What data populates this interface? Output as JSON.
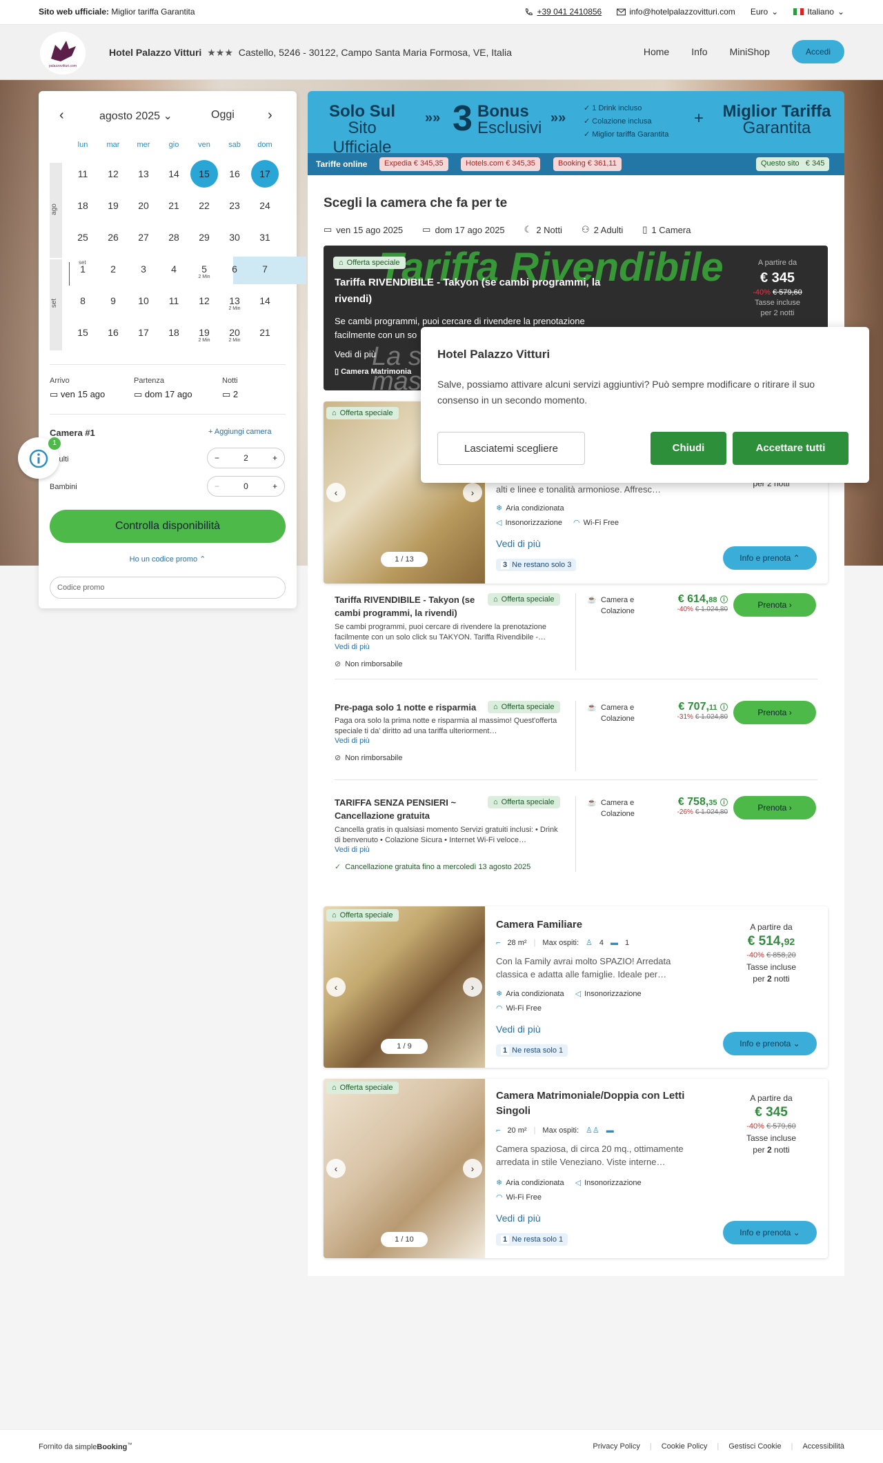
{
  "topbar": {
    "official_label": "Sito web ufficiale:",
    "official_text": "Miglior tariffa Garantita",
    "phone": "+39 041 2410856",
    "email": "info@hotelpalazzovitturi.com",
    "currency": "Euro",
    "language": "Italiano"
  },
  "header": {
    "logo_text": "palazzovitturi.com",
    "hotel_name": "Hotel Palazzo Vitturi",
    "stars": "★★★",
    "address": "Castello, 5246 - 30122, Campo Santa Maria Formosa, VE, Italia",
    "nav": [
      "Home",
      "Info",
      "MiniShop"
    ],
    "login": "Accedi"
  },
  "calendar": {
    "month": "agosto 2025",
    "today": "Oggi",
    "weekdays": [
      "lun",
      "mar",
      "mer",
      "gio",
      "ven",
      "sab",
      "dom"
    ],
    "month_labels": [
      "ago",
      "set"
    ],
    "set_label": "set",
    "rows": [
      [
        {
          "d": "11"
        },
        {
          "d": "12"
        },
        {
          "d": "13"
        },
        {
          "d": "14"
        },
        {
          "d": "15"
        },
        {
          "d": "16"
        },
        {
          "d": "17"
        }
      ],
      [
        {
          "d": "18"
        },
        {
          "d": "19"
        },
        {
          "d": "20"
        },
        {
          "d": "21"
        },
        {
          "d": "22"
        },
        {
          "d": "23"
        },
        {
          "d": "24"
        }
      ],
      [
        {
          "d": "25"
        },
        {
          "d": "26"
        },
        {
          "d": "27"
        },
        {
          "d": "28"
        },
        {
          "d": "29"
        },
        {
          "d": "30"
        },
        {
          "d": "31"
        }
      ],
      [
        {
          "d": "1"
        },
        {
          "d": "2"
        },
        {
          "d": "3"
        },
        {
          "d": "4"
        },
        {
          "d": "5",
          "s": "2 Min"
        },
        {
          "d": "6"
        },
        {
          "d": "7"
        }
      ],
      [
        {
          "d": "8"
        },
        {
          "d": "9"
        },
        {
          "d": "10"
        },
        {
          "d": "11"
        },
        {
          "d": "12"
        },
        {
          "d": "13",
          "s": "2 Min"
        },
        {
          "d": "14"
        }
      ],
      [
        {
          "d": "15"
        },
        {
          "d": "16"
        },
        {
          "d": "17"
        },
        {
          "d": "18"
        },
        {
          "d": "19",
          "s": "2 Min"
        },
        {
          "d": "20",
          "s": "2 Min"
        },
        {
          "d": "21"
        }
      ]
    ]
  },
  "stay": {
    "arrivo_label": "Arrivo",
    "arrivo": "ven 15 ago",
    "partenza_label": "Partenza",
    "partenza": "dom 17 ago",
    "notti_label": "Notti",
    "notti": "2"
  },
  "rooms_form": {
    "camera": "Camera #1",
    "add_room": "Aggiungi camera",
    "adults_label": "Adulti",
    "adults": "2",
    "children_label": "Bambini",
    "children": "0",
    "check": "Controlla disponibilità",
    "promo_link": "Ho un codice promo",
    "promo_placeholder": "Codice promo",
    "info_badge_count": "1"
  },
  "banner": {
    "solo1": "Solo Sul",
    "solo2": "Sito Ufficiale",
    "num": "3",
    "bonus1": "Bonus",
    "bonus2": "Esclusivi",
    "list": [
      "1 Drink incluso",
      "Colazione inclusa",
      "Miglior tariffa Garantita"
    ],
    "plus": "+",
    "best1": "Miglior Tariffa",
    "best2": "Garantita",
    "tariffe": "Tariffe online",
    "chips": [
      "Expedia € 345,35",
      "Hotels.com € 345,35",
      "Booking € 361,11"
    ],
    "this_site": "Questo sito   € 345"
  },
  "search": {
    "title": "Scegli la camera che fa per te",
    "from": "ven 15 ago 2025",
    "to": "dom 17 ago 2025",
    "nights": "2 Notti",
    "adults": "2 Adulti",
    "rooms": "1 Camera"
  },
  "dark_offer": {
    "badge": "Offerta speciale",
    "watermark": "Tariffa Rivendibile",
    "watermark2": "La so",
    "watermark3": "mas",
    "name": "Tariffa RIVENDIBILE - Takyon (se cambi programmi, la rivendi)",
    "desc": "Se cambi programmi, puoi cercare di rivendere la prenotazione facilmente con un so",
    "vedi": "Vedi di più",
    "room": "Camera Matrimonia",
    "from": "A partire da",
    "price": "€ 345",
    "disc": "-40%",
    "old": "€ 579,60",
    "tax": "Tasse incluse",
    "per": "per 2 notti"
  },
  "cookie": {
    "title": "Hotel Palazzo Vitturi",
    "text": "Salve, possiamo attivare alcuni servizi aggiuntivi? Può sempre modificare o ritirare il suo consenso in un secondo momento.",
    "choose": "Lasciatemi scegliere",
    "close": "Chiudi",
    "accept": "Accettare tutti"
  },
  "room1": {
    "badge": "Offerta speciale",
    "desc_tail": "alti e linee e tonalità armoniose. Affresc…",
    "per_tail": "per 2 notti",
    "am1": "Aria condizionata",
    "am2": "Insonorizzazione",
    "am3": "Wi-Fi Free",
    "vedi": "Vedi di più",
    "remain_n": "3",
    "remain": "Ne restano solo 3",
    "count": "1 / 13",
    "info": "Info e prenota"
  },
  "rates": [
    {
      "name": "Tariffa RIVENDIBILE - Takyon (se cambi programmi, la rivendi)",
      "badge": "Offerta speciale",
      "desc": "Se cambi programmi, puoi cercare di rivendere la prenotazione facilmente con un solo click su TAKYON. Tariffa Rivendibile -…",
      "vedi": "Vedi di più",
      "policy": "Non rimborsabile",
      "meal": "Camera e Colazione",
      "price_int": "€ 614,",
      "price_dec": "88",
      "disc": "-40%",
      "old": "€ 1.024,80",
      "book": "Prenota"
    },
    {
      "name": "Pre-paga solo 1 notte e risparmia",
      "badge": "Offerta speciale",
      "desc": "Paga ora solo la prima notte e risparmia al massimo! Quest'offerta speciale ti da' diritto ad una tariffa ulteriorment…",
      "vedi": "Vedi di più",
      "policy": "Non rimborsabile",
      "meal": "Camera e Colazione",
      "price_int": "€ 707,",
      "price_dec": "11",
      "disc": "-31%",
      "old": "€ 1.024,80",
      "book": "Prenota"
    },
    {
      "name": "TARIFFA SENZA PENSIERI ~ Cancellazione gratuita",
      "badge": "Offerta speciale",
      "desc": "Cancella gratis in qualsiasi momento Servizi gratuiti inclusi: • Drink di benvenuto • Colazione Sicura • Internet Wi-Fi veloce…",
      "vedi": "Vedi di più",
      "policy": "Cancellazione gratuita fino a mercoledì 13 agosto 2025",
      "meal": "Camera e Colazione",
      "price_int": "€ 758,",
      "price_dec": "35",
      "disc": "-26%",
      "old": "€ 1.024,80",
      "book": "Prenota"
    }
  ],
  "room2": {
    "badge": "Offerta speciale",
    "name": "Camera Familiare",
    "size": "28 m²",
    "max": "Max ospiti:",
    "adults": "4",
    "kids": "1",
    "desc": "Con la Family avrai molto SPAZIO! Arredata classica e adatta alle famiglie. Ideale per…",
    "am1": "Aria condizionata",
    "am2": "Insonorizzazione",
    "am3": "Wi-Fi Free",
    "vedi": "Vedi di più",
    "remain_n": "1",
    "remain": "Ne resta solo 1",
    "from": "A partire da",
    "price_int": "€ 514,",
    "price_dec": "92",
    "disc": "-40%",
    "old": "€ 858,20",
    "tax": "Tasse incluse",
    "per_pre": "per",
    "per_n": "2",
    "per_post": "notti",
    "count": "1 / 9",
    "info": "Info e prenota"
  },
  "room3": {
    "badge": "Offerta speciale",
    "name": "Camera Matrimoniale/Doppia con Letti Singoli",
    "size": "20 m²",
    "max": "Max ospiti:",
    "desc": "Camera spaziosa, di circa 20 mq., ottimamente arredata in stile Veneziano. Viste interne…",
    "am1": "Aria condizionata",
    "am2": "Insonorizzazione",
    "am3": "Wi-Fi Free",
    "vedi": "Vedi di più",
    "remain_n": "1",
    "remain": "Ne resta solo 1",
    "from": "A partire da",
    "price": "€ 345",
    "disc": "-40%",
    "old": "€ 579,60",
    "tax": "Tasse incluse",
    "per_pre": "per",
    "per_n": "2",
    "per_post": "notti",
    "count": "1 / 10",
    "info": "Info e prenota"
  },
  "footer": {
    "powered": "Fornito da",
    "brand_simple": "simple",
    "brand_booking": "Booking",
    "brand_tm": "™",
    "links": [
      "Privacy Policy",
      "Cookie Policy",
      "Gestisci Cookie",
      "Accessibilità"
    ]
  },
  "colors": {
    "accent_blue": "#3aaed8",
    "green": "#4db948",
    "price_green": "#2f8c3b",
    "discount_red": "#c73030"
  }
}
